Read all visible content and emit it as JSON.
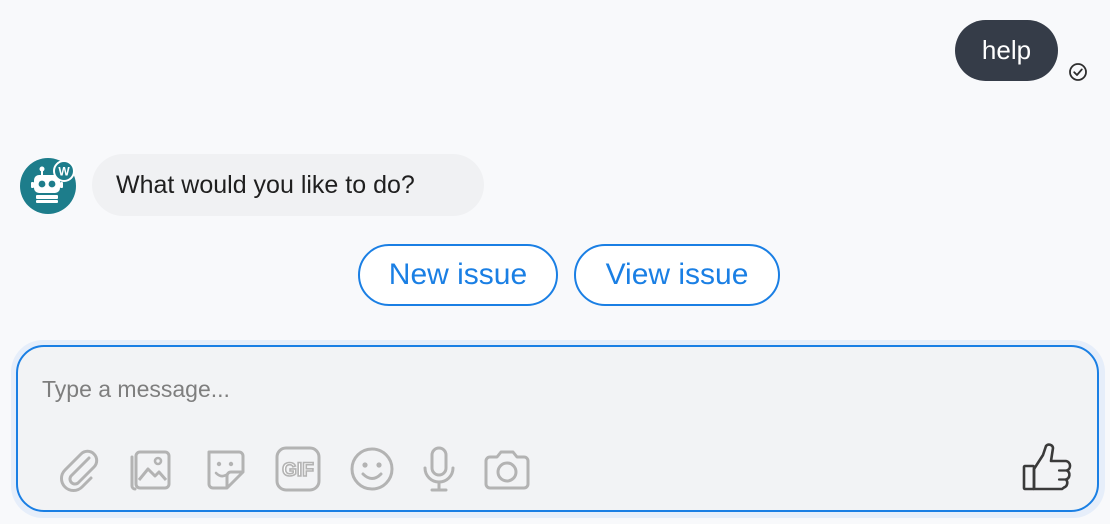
{
  "conversation": {
    "user_message": "help",
    "bot_message": "What would you like to do?",
    "bot_avatar_badge": "W",
    "quick_replies": [
      "New issue",
      "View issue"
    ]
  },
  "composer": {
    "placeholder": "Type a message...",
    "gif_label": "GIF",
    "tools": [
      "attachment-icon",
      "image-icon",
      "sticker-icon",
      "gif-icon",
      "emoji-icon",
      "microphone-icon",
      "camera-icon"
    ],
    "send_icon": "thumbs-up-icon"
  },
  "colors": {
    "accent": "#1a7fe4",
    "user_bubble": "#353c48",
    "bot_bubble": "#f0f1f3",
    "avatar": "#1d7d8b",
    "background": "#f8f9fb",
    "icon_gray": "#b3b3b3"
  }
}
